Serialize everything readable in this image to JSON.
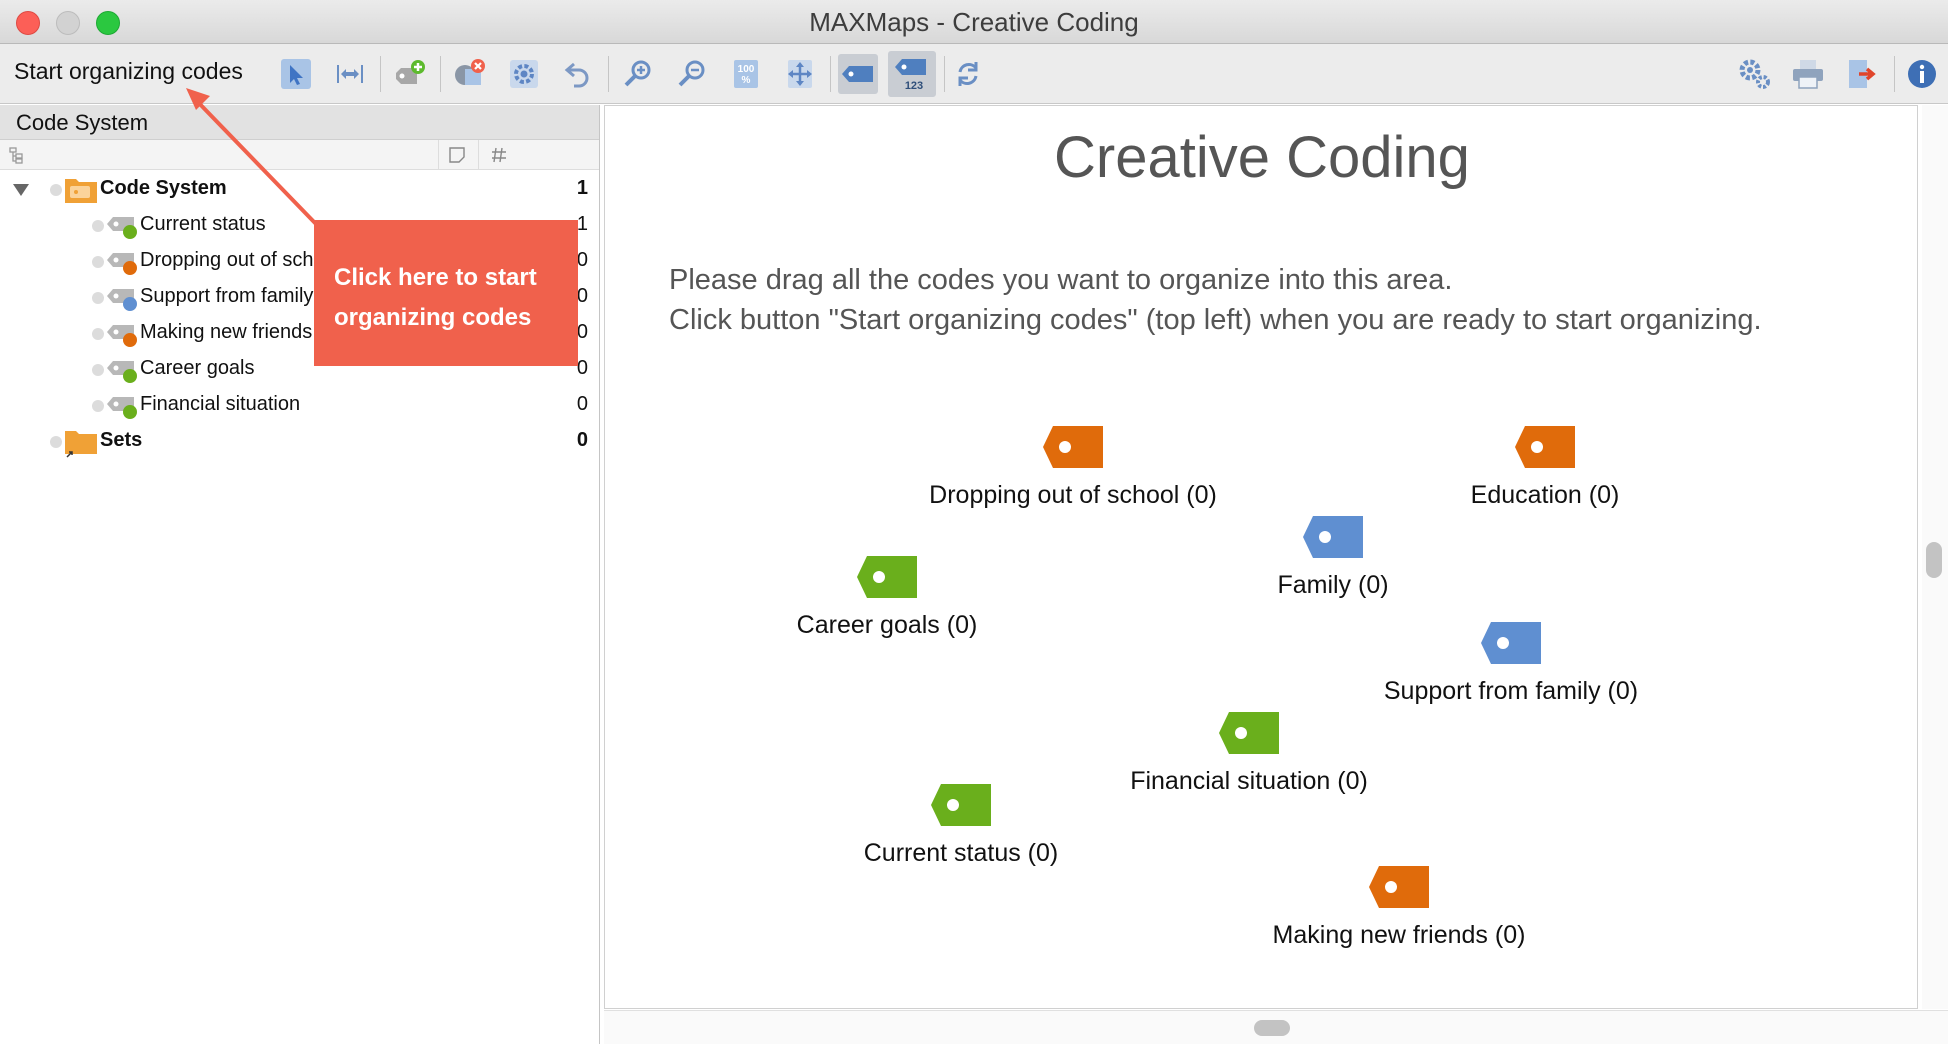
{
  "window": {
    "title": "MAXMaps - Creative Coding"
  },
  "toolbar": {
    "start_label": "Start organizing codes",
    "icons": [
      "select-pointer",
      "align-horizontal",
      "add-code",
      "remove-code",
      "settings",
      "undo",
      "zoom-in",
      "zoom-out",
      "zoom-100",
      "fit-window",
      "code-tag",
      "code-tag-frequency",
      "sync",
      "preferences",
      "print",
      "export",
      "info"
    ]
  },
  "left_panel": {
    "header": "Code System",
    "tree": [
      {
        "label": "Code System",
        "count": "1",
        "level": 0,
        "bold": true,
        "color": "#f0a136"
      },
      {
        "label": "Current status",
        "count": "1",
        "level": 1,
        "color": "#6aaf1c"
      },
      {
        "label": "Dropping out of school",
        "count": "0",
        "level": 1,
        "color": "#e06b0b"
      },
      {
        "label": "Support from family",
        "count": "0",
        "level": 1,
        "color": "#5f8fd1"
      },
      {
        "label": "Making new friends",
        "count": "0",
        "level": 1,
        "color": "#e06b0b"
      },
      {
        "label": "Career goals",
        "count": "0",
        "level": 1,
        "color": "#6aaf1c"
      },
      {
        "label": "Financial situation",
        "count": "0",
        "level": 1,
        "color": "#6aaf1c"
      },
      {
        "label": "Sets",
        "count": "0",
        "level": 0,
        "bold": true,
        "color": "#f0a136"
      }
    ]
  },
  "map": {
    "title": "Creative Coding",
    "instruction_1": "Please drag all the codes you want to organize into this area.",
    "instruction_2": "Click button \"Start organizing codes\" (top left) when you are ready to start organizing.",
    "codes": [
      {
        "label": "Dropping out of school (0)",
        "color": "#e06b0b"
      },
      {
        "label": "Education (0)",
        "color": "#e06b0b"
      },
      {
        "label": "Family (0)",
        "color": "#5f8fd1"
      },
      {
        "label": "Career goals (0)",
        "color": "#6aaf1c"
      },
      {
        "label": "Support from family (0)",
        "color": "#5f8fd1"
      },
      {
        "label": "Financial situation (0)",
        "color": "#6aaf1c"
      },
      {
        "label": "Current status (0)",
        "color": "#6aaf1c"
      },
      {
        "label": "Making new friends (0)",
        "color": "#e06b0b"
      }
    ]
  },
  "callout": {
    "text": "Click here to start organizing codes"
  }
}
